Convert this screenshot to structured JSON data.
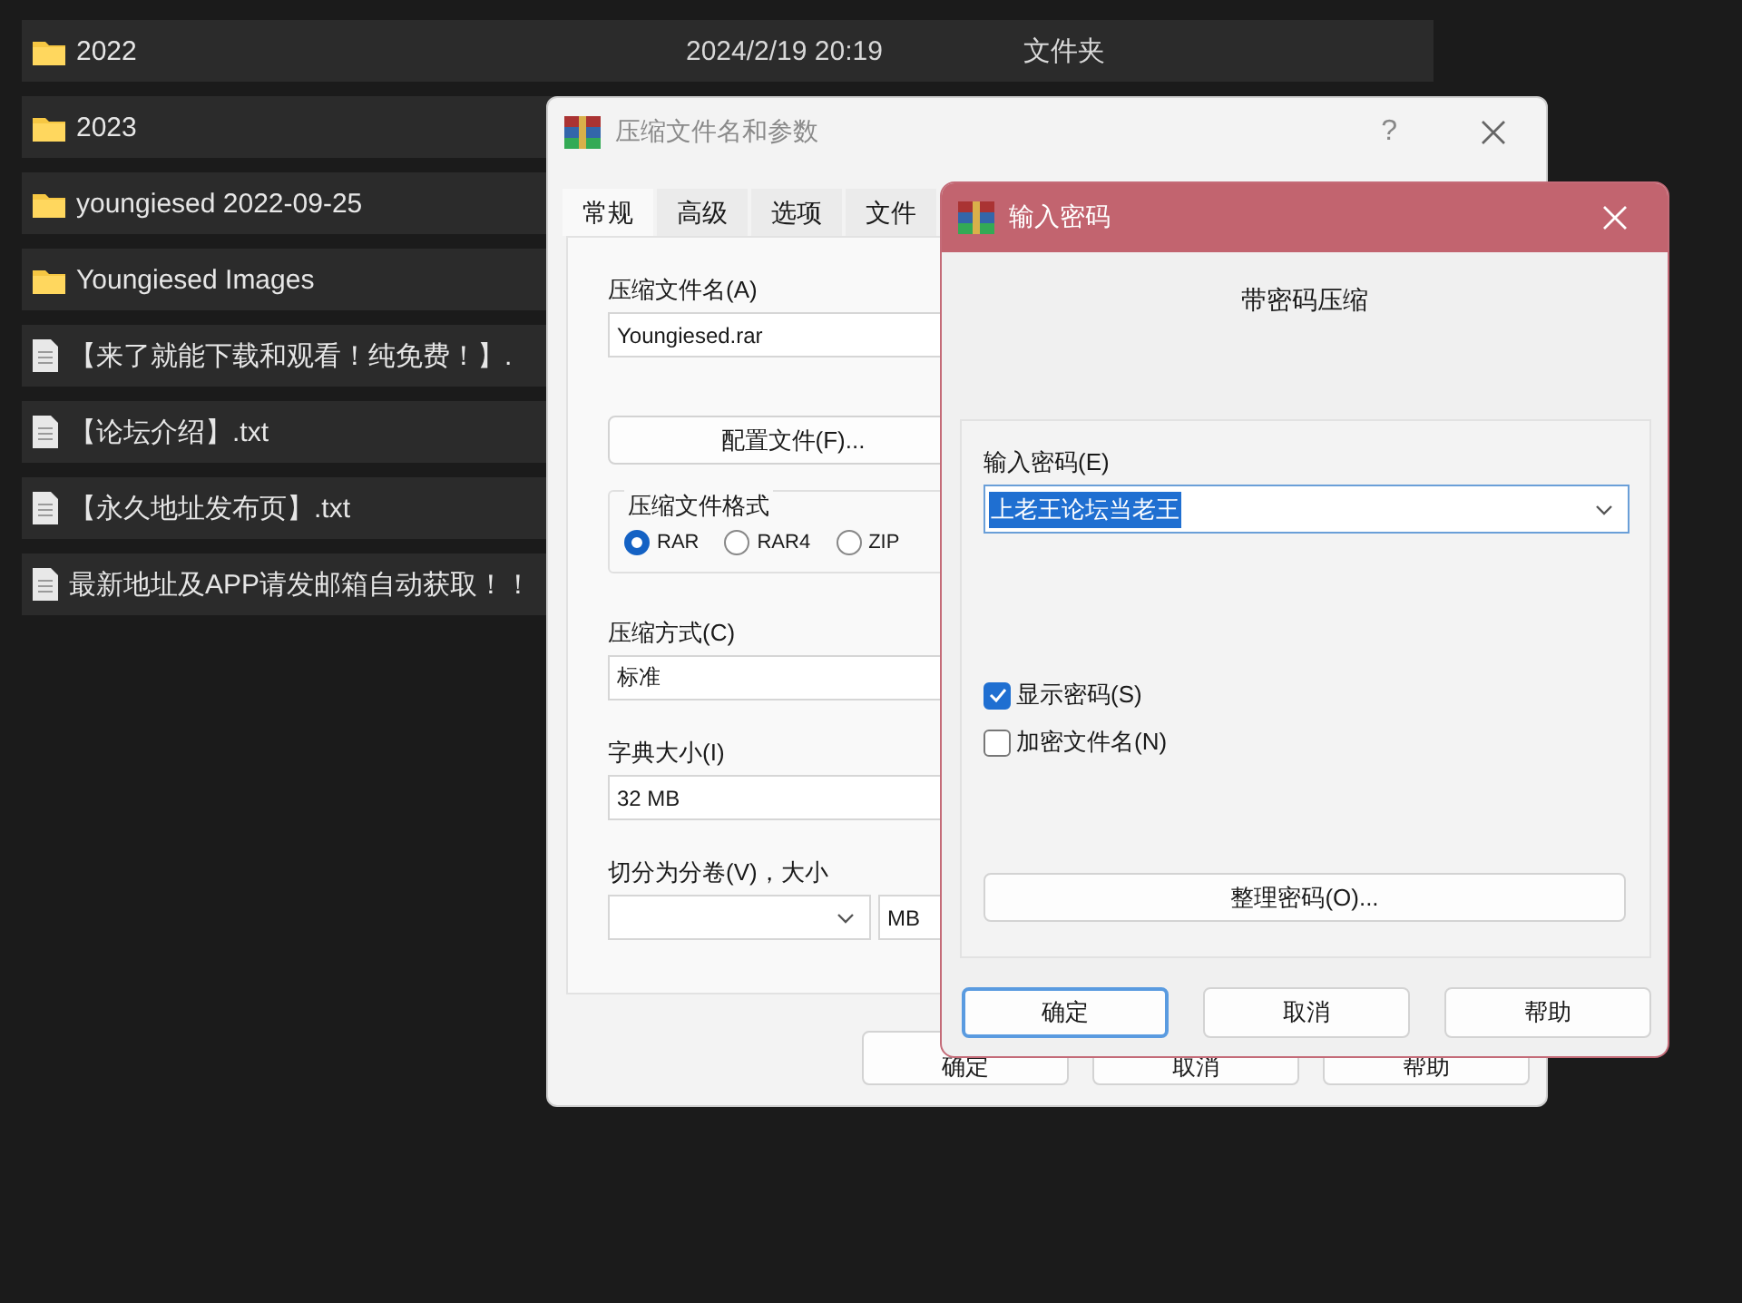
{
  "files": [
    {
      "kind": "folder",
      "name": "2022",
      "date": "2024/2/19 20:19",
      "type": "文件夹"
    },
    {
      "kind": "folder",
      "name": "2023"
    },
    {
      "kind": "folder",
      "name": "youngiesed 2022-09-25"
    },
    {
      "kind": "folder",
      "name": "Youngiesed Images"
    },
    {
      "kind": "file",
      "name": "【来了就能下载和观看！纯免费！】."
    },
    {
      "kind": "file",
      "name": "【论坛介绍】.txt"
    },
    {
      "kind": "file",
      "name": "【永久地址发布页】.txt"
    },
    {
      "kind": "file",
      "name": "最新地址及APP请发邮箱自动获取！！"
    }
  ],
  "archive_dialog": {
    "title": "压缩文件名和参数",
    "help": "?",
    "tabs": [
      {
        "label": "常规",
        "selected": true
      },
      {
        "label": "高级",
        "selected": false
      },
      {
        "label": "选项",
        "selected": false
      },
      {
        "label": "文件",
        "selected": false
      }
    ],
    "archive_name": {
      "label": "压缩文件名(A)",
      "value": "Youngiesed.rar"
    },
    "profiles_button": "配置文件(F)...",
    "format": {
      "title": "压缩文件格式",
      "options": [
        {
          "label": "RAR",
          "selected": true
        },
        {
          "label": "RAR4",
          "selected": false
        },
        {
          "label": "ZIP",
          "selected": false
        }
      ]
    },
    "method": {
      "label": "压缩方式(C)",
      "value": "标准"
    },
    "dictionary": {
      "label": "字典大小(I)",
      "value": "32 MB"
    },
    "split": {
      "label": "切分为分卷(V)，大小",
      "unit": "MB"
    },
    "buttons": [
      "确定",
      "取消",
      "帮助"
    ]
  },
  "password_dialog": {
    "title": "输入密码",
    "heading": "带密码压缩",
    "password": {
      "label": "输入密码(E)",
      "value": "上老王论坛当老王",
      "selected": true
    },
    "options": [
      {
        "label": "显示密码(S)",
        "checked": true
      },
      {
        "label": "加密文件名(N)",
        "checked": false
      }
    ],
    "organize_button": "整理密码(O)...",
    "buttons": [
      {
        "label": "确定",
        "default": true
      },
      {
        "label": "取消",
        "default": false
      },
      {
        "label": "帮助",
        "default": false
      }
    ]
  }
}
